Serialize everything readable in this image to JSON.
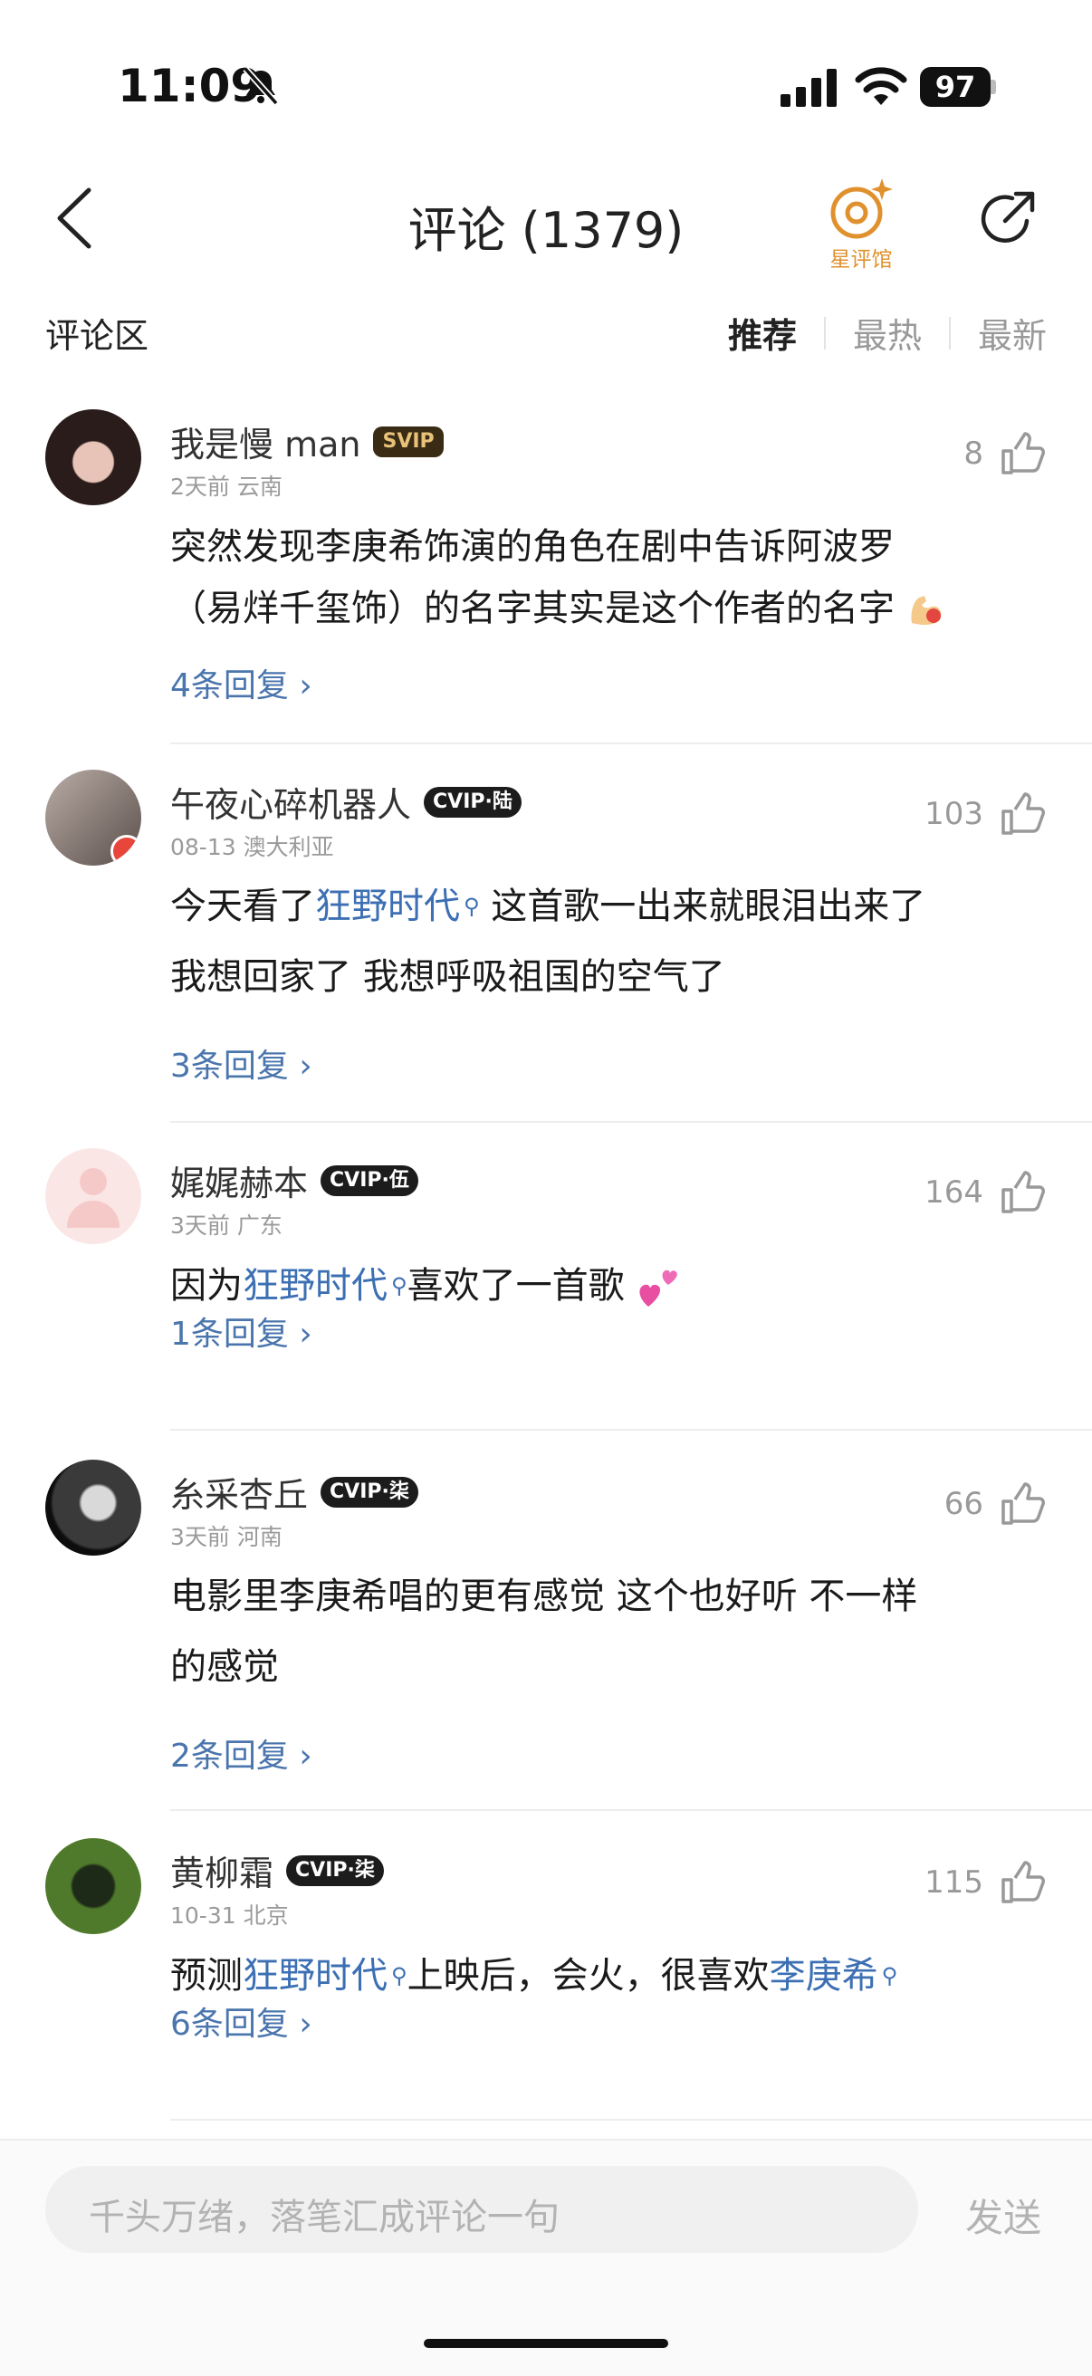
{
  "status_bar": {
    "time": "11:09",
    "battery": "97"
  },
  "header": {
    "title": "评论 (1379)",
    "star_hall_label": "星评馆"
  },
  "section": {
    "title": "评论区",
    "sort_tabs": [
      "推荐",
      "最热",
      "最新"
    ],
    "active_tab": "推荐"
  },
  "comments": [
    {
      "nickname": "我是慢 man",
      "badge": "SVIP",
      "meta": "2天前 云南",
      "likes": "8",
      "text_line1": "突然发现李庚希饰演的角色在剧中告诉阿波罗",
      "text_line2": "（易烊千玺饰）的名字其实是这个作者的名字",
      "emoji": "flexed-biceps-emoji",
      "replies": "4条回复"
    },
    {
      "nickname": "午夜心碎机器人",
      "badge": "CVIP·陆",
      "meta": "08-13 澳大利亚",
      "likes": "103",
      "text_pre": "今天看了",
      "topic": "狂野时代",
      "text_post": " 这首歌一出来就眼泪出来了",
      "text_line2": "我想回家了 我想呼吸祖国的空气了",
      "replies": "3条回复"
    },
    {
      "nickname": "娓娓赫本",
      "badge": "CVIP·伍",
      "meta": "3天前 广东",
      "likes": "164",
      "text_pre": "因为",
      "topic": "狂野时代",
      "text_post": "喜欢了一首歌",
      "emoji": "two-hearts-emoji",
      "replies": "1条回复"
    },
    {
      "nickname": "糸采杏丘",
      "badge": "CVIP·柒",
      "meta": "3天前 河南",
      "likes": "66",
      "text_line1": "电影里李庚希唱的更有感觉 这个也好听 不一样",
      "text_line2": "的感觉",
      "replies": "2条回复"
    },
    {
      "nickname": "黄柳霜",
      "badge": "CVIP·柒",
      "meta": "10-31 北京",
      "likes": "115",
      "text_pre": "预测",
      "topic": "狂野时代",
      "text_mid": "上映后，会火，很喜欢",
      "topic2": "李庚希",
      "replies": "6条回复"
    }
  ],
  "composer": {
    "placeholder": "千头万绪，落笔汇成评论一句",
    "send_label": "发送"
  },
  "colors": {
    "link": "#4a75ad",
    "topic": "#3c6fb3",
    "star_hall": "#e0912e"
  }
}
